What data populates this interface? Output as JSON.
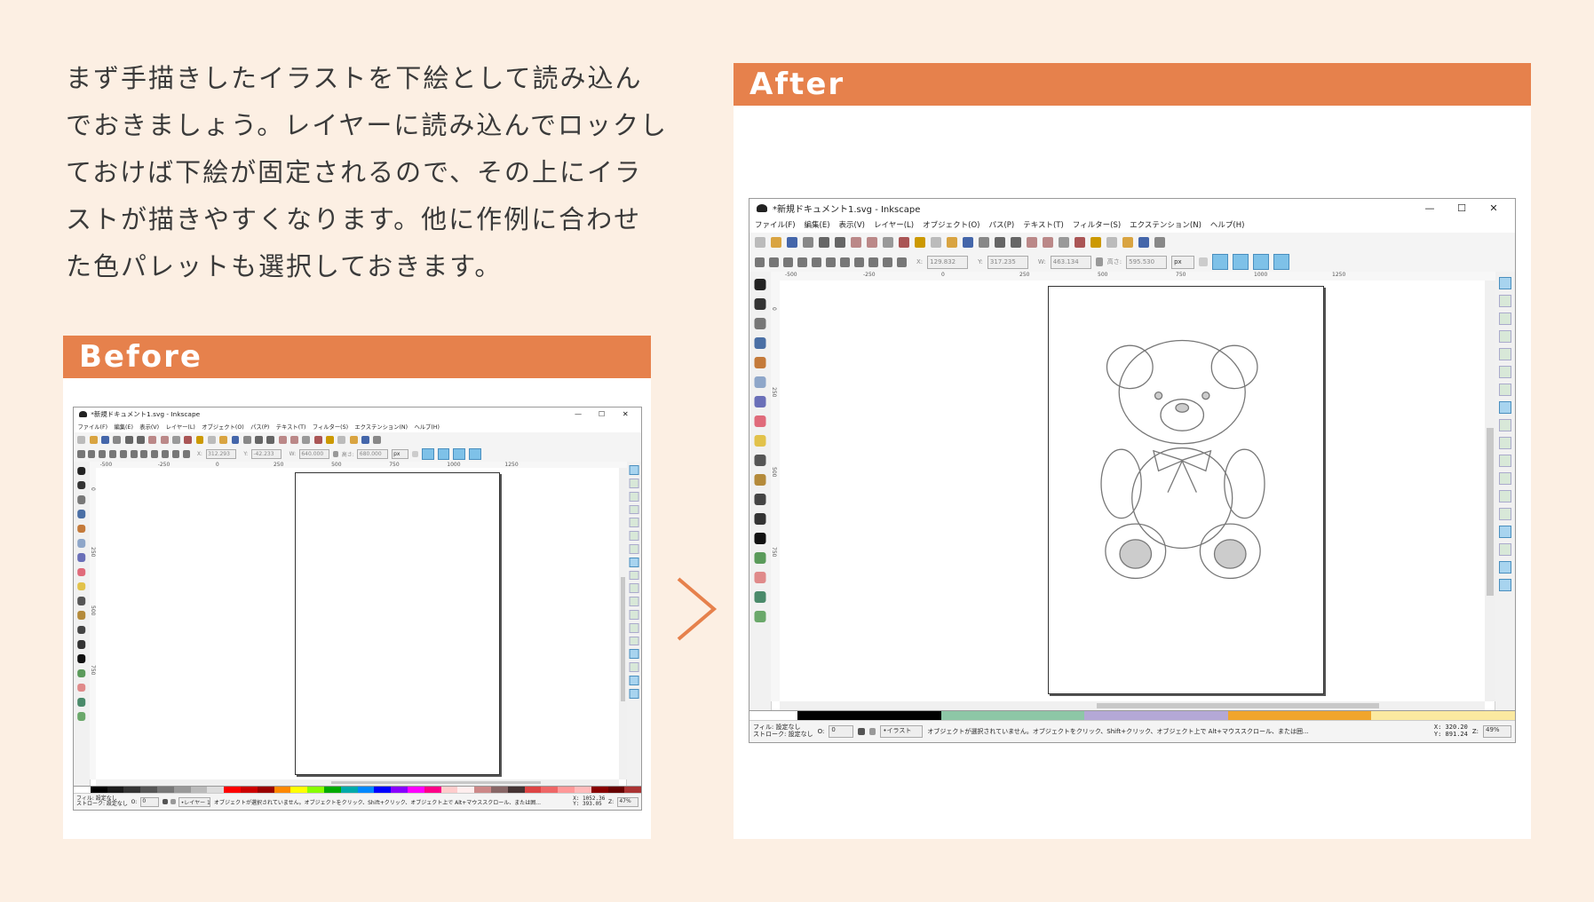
{
  "intro": {
    "lines": [
      "まず手描きしたイラストを下絵として読み込ん",
      "でおきましょう。レイヤーに読み込んでロックし",
      "ておけば下絵が固定されるので、その上にイラ",
      "ストが描きやすくなります。他に作例に合わせ",
      "た色パレットも選択しておきます。"
    ]
  },
  "before": {
    "label": "Before",
    "window": {
      "title": "*新規ドキュメント1.svg - Inkscape",
      "x": "312.293",
      "y": "-42.233",
      "w": "640.000",
      "h": "680.000",
      "unit": "px",
      "layer": "•レイヤー 1",
      "cursor_x": "X: 1052.36",
      "cursor_y": "Y: 393.05",
      "zoom": "47%",
      "opacity_value": "0"
    }
  },
  "after": {
    "label": "After",
    "window": {
      "title": "*新規ドキュメント1.svg - Inkscape",
      "x": "129.832",
      "y": "317.235",
      "w": "463.134",
      "h": "595.530",
      "unit": "px",
      "layer": "•イラスト",
      "cursor_x": "X: 320.20",
      "cursor_y": "Y: 891.24",
      "zoom": "49%",
      "opacity_value": "0"
    }
  },
  "shared": {
    "menus": [
      "ファイル(F)",
      "編集(E)",
      "表示(V)",
      "レイヤー(L)",
      "オブジェクト(O)",
      "パス(P)",
      "テキスト(T)",
      "フィルター(S)",
      "エクステンション(N)",
      "ヘルプ(H)"
    ],
    "fill_label": "フィル:",
    "stroke_label": "ストローク:",
    "fill_value": "設定なし",
    "stroke_value": "設定なし",
    "opacity_label": "O:",
    "zoom_label": "Z:",
    "status_message": "オブジェクトが選択されていません。オブジェクトをクリック、Shift+クリック、オブジェクト上で Alt+マウススクロール、または囲...",
    "x_label": "X:",
    "y_label": "Y:",
    "w_label": "W:",
    "h_label": "高さ:",
    "ruler_h_labels": [
      "-500",
      "-250",
      "0",
      "250",
      "500",
      "750",
      "1000",
      "1250"
    ],
    "ruler_v_labels": [
      "0",
      "250",
      "500",
      "750"
    ]
  },
  "colors": {
    "background": "#fcefe3",
    "accent": "#e6814c",
    "toggle_blue": "#7ec1e8"
  }
}
